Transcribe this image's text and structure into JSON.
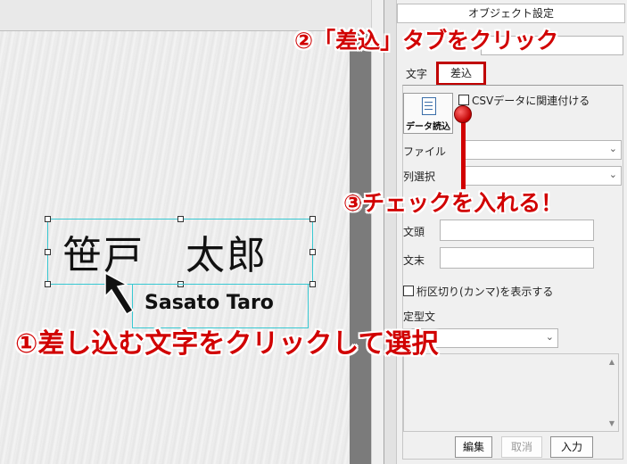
{
  "panel": {
    "title": "オブジェクト設定",
    "tabs": [
      {
        "label": "文字",
        "selected": false
      },
      {
        "label": "差込",
        "selected": true
      }
    ],
    "data_load_button": "データ読込",
    "csv_checkbox_label": "CSVデータに関連付ける",
    "file_label": "ファイル",
    "column_label": "列選択",
    "prefix_label": "文頭",
    "suffix_label": "文末",
    "comma_checkbox_label": "桁区切り(カンマ)を表示する",
    "template_label": "定型文",
    "buttons": {
      "edit": "編集",
      "cancel": "取消",
      "enter": "入力"
    }
  },
  "canvas": {
    "name_kanji": "笹戸　太郎",
    "name_roman": "Sasato Taro"
  },
  "annotations": {
    "step2": "②「差込」タブをクリック",
    "step3": "③チェックを入れる！",
    "step1": "①差し込む文字をクリックして選択"
  },
  "colors": {
    "annotation": "#d10000",
    "selection": "#37c8d2"
  },
  "icons": {
    "dropdown": "chevron-down-icon",
    "data_load": "document-icon"
  }
}
